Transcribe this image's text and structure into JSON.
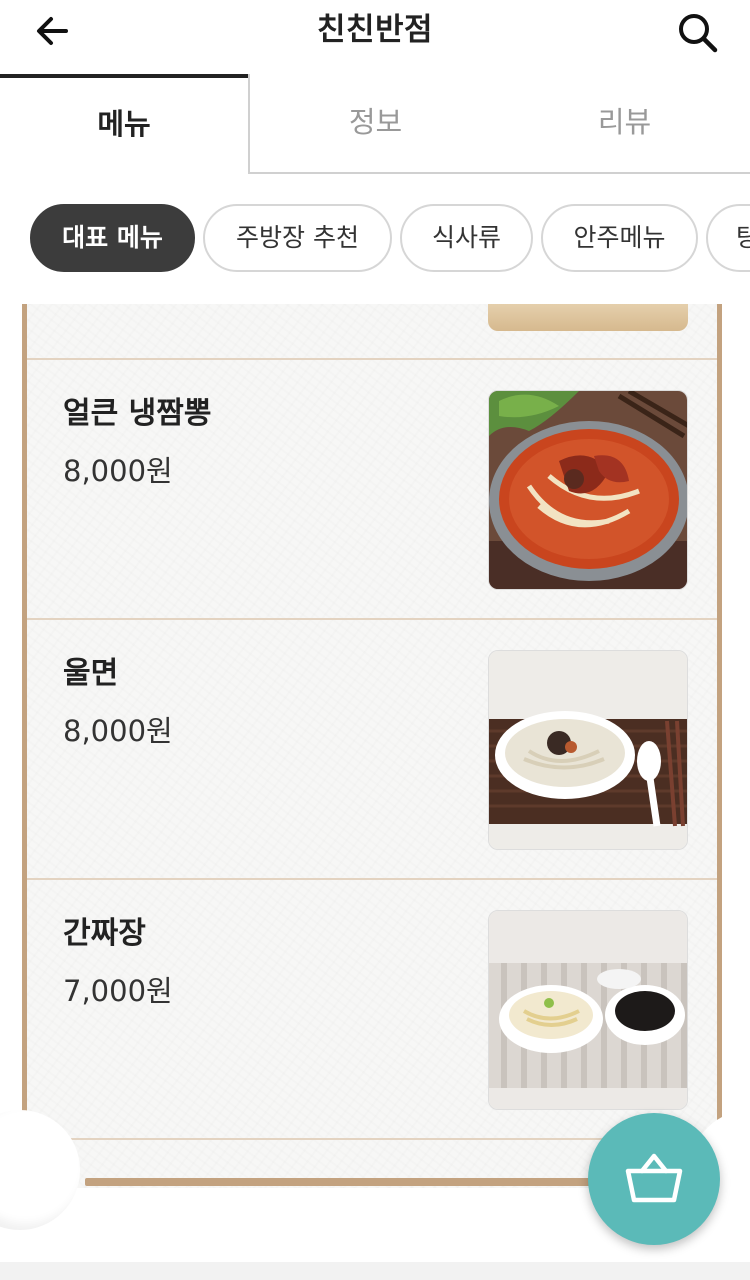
{
  "header": {
    "title": "친친반점",
    "back_icon": "arrow-left-icon",
    "search_icon": "search-icon"
  },
  "tabs": [
    {
      "label": "메뉴",
      "active": true
    },
    {
      "label": "정보",
      "active": false
    },
    {
      "label": "리뷰",
      "active": false
    }
  ],
  "categories": [
    {
      "label": "대표 메뉴",
      "active": true
    },
    {
      "label": "주방장 추천",
      "active": false
    },
    {
      "label": "식사류",
      "active": false
    },
    {
      "label": "안주메뉴",
      "active": false
    },
    {
      "label": "탕",
      "active": false
    }
  ],
  "menu_items": [
    {
      "name": "얼큰 냉짬뽕",
      "price": "8,000원"
    },
    {
      "name": "울면",
      "price": "8,000원"
    },
    {
      "name": "간짜장",
      "price": "7,000원"
    }
  ],
  "cart": {
    "icon": "shopping-basket-icon"
  },
  "colors": {
    "accent": "#5bbab8",
    "paper_border": "#c3a27f",
    "chip_active": "#3c3c3c"
  }
}
